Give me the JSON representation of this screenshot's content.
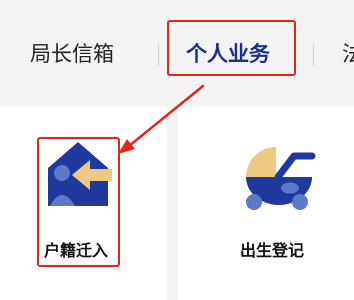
{
  "tabs": [
    {
      "label": "局长信箱",
      "active": false
    },
    {
      "label": "个人业务",
      "active": true
    },
    {
      "label": "法",
      "active": false
    }
  ],
  "services": [
    {
      "label": "户籍迁入",
      "icon": "household-move-in-icon",
      "highlighted": true
    },
    {
      "label": "出生登记",
      "icon": "baby-stroller-icon",
      "highlighted": false
    }
  ],
  "colors": {
    "brand_blue": "#12318f",
    "icon_blue": "#1e3a9e",
    "icon_light_blue": "#5b7ac8",
    "icon_gold": "#efc982",
    "highlight_red": "#e3261b",
    "tab_background": "#f4f4f5"
  }
}
